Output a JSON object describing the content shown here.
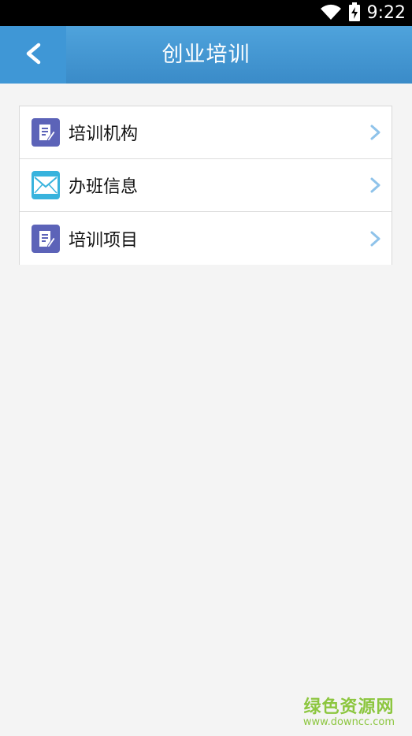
{
  "status_bar": {
    "time": "9:22"
  },
  "header": {
    "title": "创业培训"
  },
  "menu": {
    "items": [
      {
        "label": "培训机构",
        "icon": "edit-note-icon"
      },
      {
        "label": "办班信息",
        "icon": "envelope-icon"
      },
      {
        "label": "培训项目",
        "icon": "edit-note-icon"
      }
    ]
  },
  "watermark": {
    "title": "绿色资源网",
    "url": "www.downcc.com"
  },
  "colors": {
    "header": "#4a9fd9",
    "accent_icon": "#5c63b8",
    "envelope": "#38b3dd",
    "chevron": "#8fc3ea",
    "watermark": "#8cc63f"
  }
}
